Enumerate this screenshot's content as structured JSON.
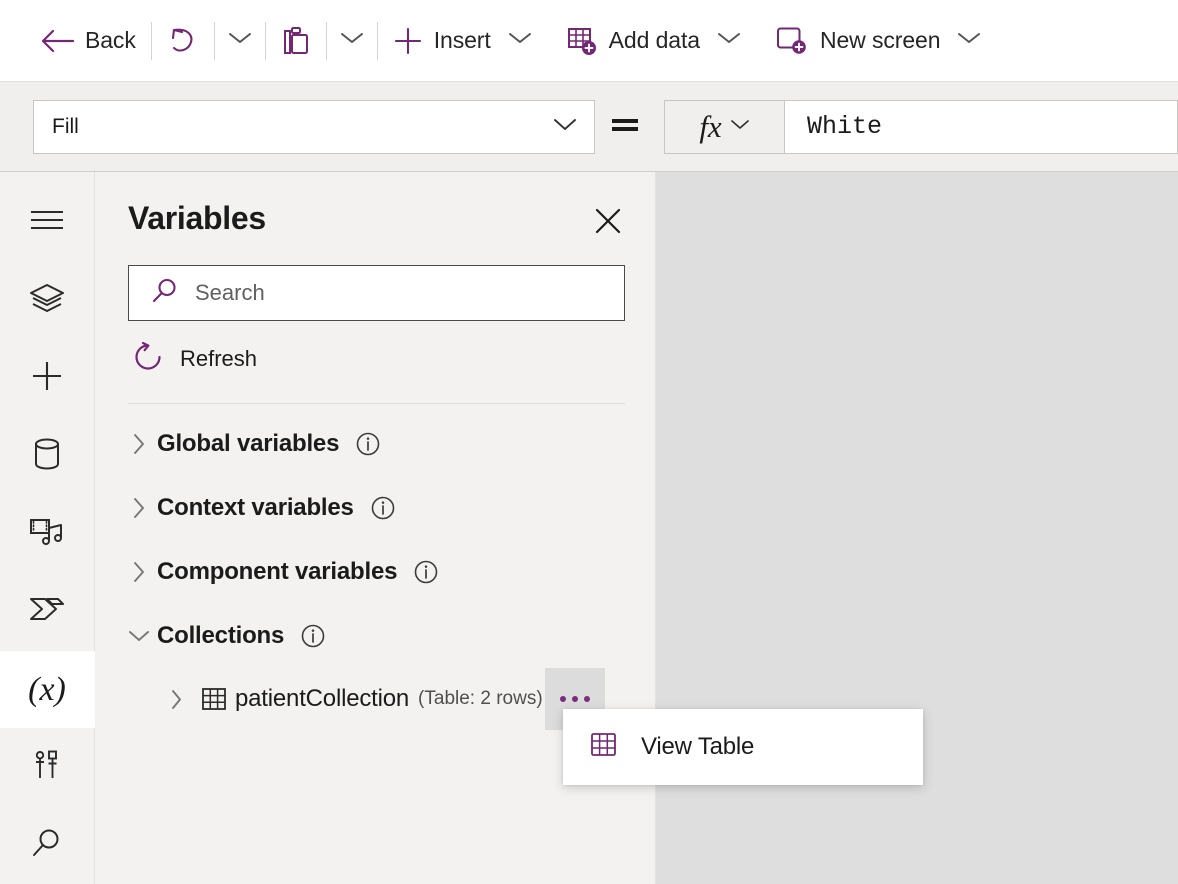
{
  "toolbar": {
    "back_label": "Back",
    "undo_icon": "undo-icon",
    "undo_caret_icon": "chevron-down-icon",
    "paste_icon": "clipboard-paste-icon",
    "paste_caret_icon": "chevron-down-icon",
    "insert_label": "Insert",
    "insert_icon": "plus-icon",
    "insert_caret_icon": "chevron-down-icon",
    "add_data_label": "Add data",
    "add_data_icon": "add-data-table-icon",
    "add_data_caret_icon": "chevron-down-icon",
    "new_screen_label": "New screen",
    "new_screen_icon": "new-screen-icon",
    "new_screen_caret_icon": "chevron-down-icon",
    "back_icon": "arrow-left-icon"
  },
  "formula_bar": {
    "property": "Fill",
    "property_caret_icon": "chevron-down-icon",
    "equals": "=",
    "fx_glyph": "fx",
    "fx_caret_icon": "chevron-down-icon",
    "formula_value": "White"
  },
  "rail": {
    "items": [
      {
        "name": "menu-icon",
        "label": "Menu",
        "selected": false
      },
      {
        "name": "tree-view-icon",
        "label": "Tree view",
        "selected": false
      },
      {
        "name": "insert-icon",
        "label": "Insert",
        "selected": false
      },
      {
        "name": "data-icon",
        "label": "Data",
        "selected": false
      },
      {
        "name": "media-icon",
        "label": "Media",
        "selected": false
      },
      {
        "name": "power-automate-icon",
        "label": "Power Automate",
        "selected": false
      },
      {
        "name": "variables-icon",
        "label": "Variables",
        "selected": true,
        "glyph": "(x)"
      },
      {
        "name": "tools-icon",
        "label": "Advanced tools",
        "selected": false
      },
      {
        "name": "search-icon",
        "label": "Search",
        "selected": false
      }
    ]
  },
  "panel": {
    "title": "Variables",
    "close_icon": "close-icon",
    "search": {
      "placeholder": "Search",
      "value": "",
      "icon": "search-icon"
    },
    "refresh": {
      "label": "Refresh",
      "icon": "refresh-icon"
    },
    "tree": [
      {
        "label": "Global variables",
        "expanded": false,
        "twisty": "chevron-right-icon",
        "info_icon": "info-icon"
      },
      {
        "label": "Context variables",
        "expanded": false,
        "twisty": "chevron-right-icon",
        "info_icon": "info-icon"
      },
      {
        "label": "Component variables",
        "expanded": false,
        "twisty": "chevron-right-icon",
        "info_icon": "info-icon"
      },
      {
        "label": "Collections",
        "expanded": true,
        "twisty": "chevron-down-icon",
        "info_icon": "info-icon"
      }
    ],
    "collection_item": {
      "name": "patientCollection",
      "meta": "(Table: 2 rows)",
      "twisty": "chevron-right-icon",
      "table_icon": "table-grid-icon",
      "more_icon": "more-ellipsis-icon"
    }
  },
  "context_menu": {
    "items": [
      {
        "label": "View Table",
        "icon": "table-grid-icon"
      }
    ]
  },
  "colors": {
    "accent_purple": "#742774",
    "panel_bg": "#f3f2f1",
    "canvas_bg": "#dedede",
    "propbar_bg": "#f0efee",
    "text_primary": "#1b1b1b",
    "text_secondary": "#616161"
  }
}
